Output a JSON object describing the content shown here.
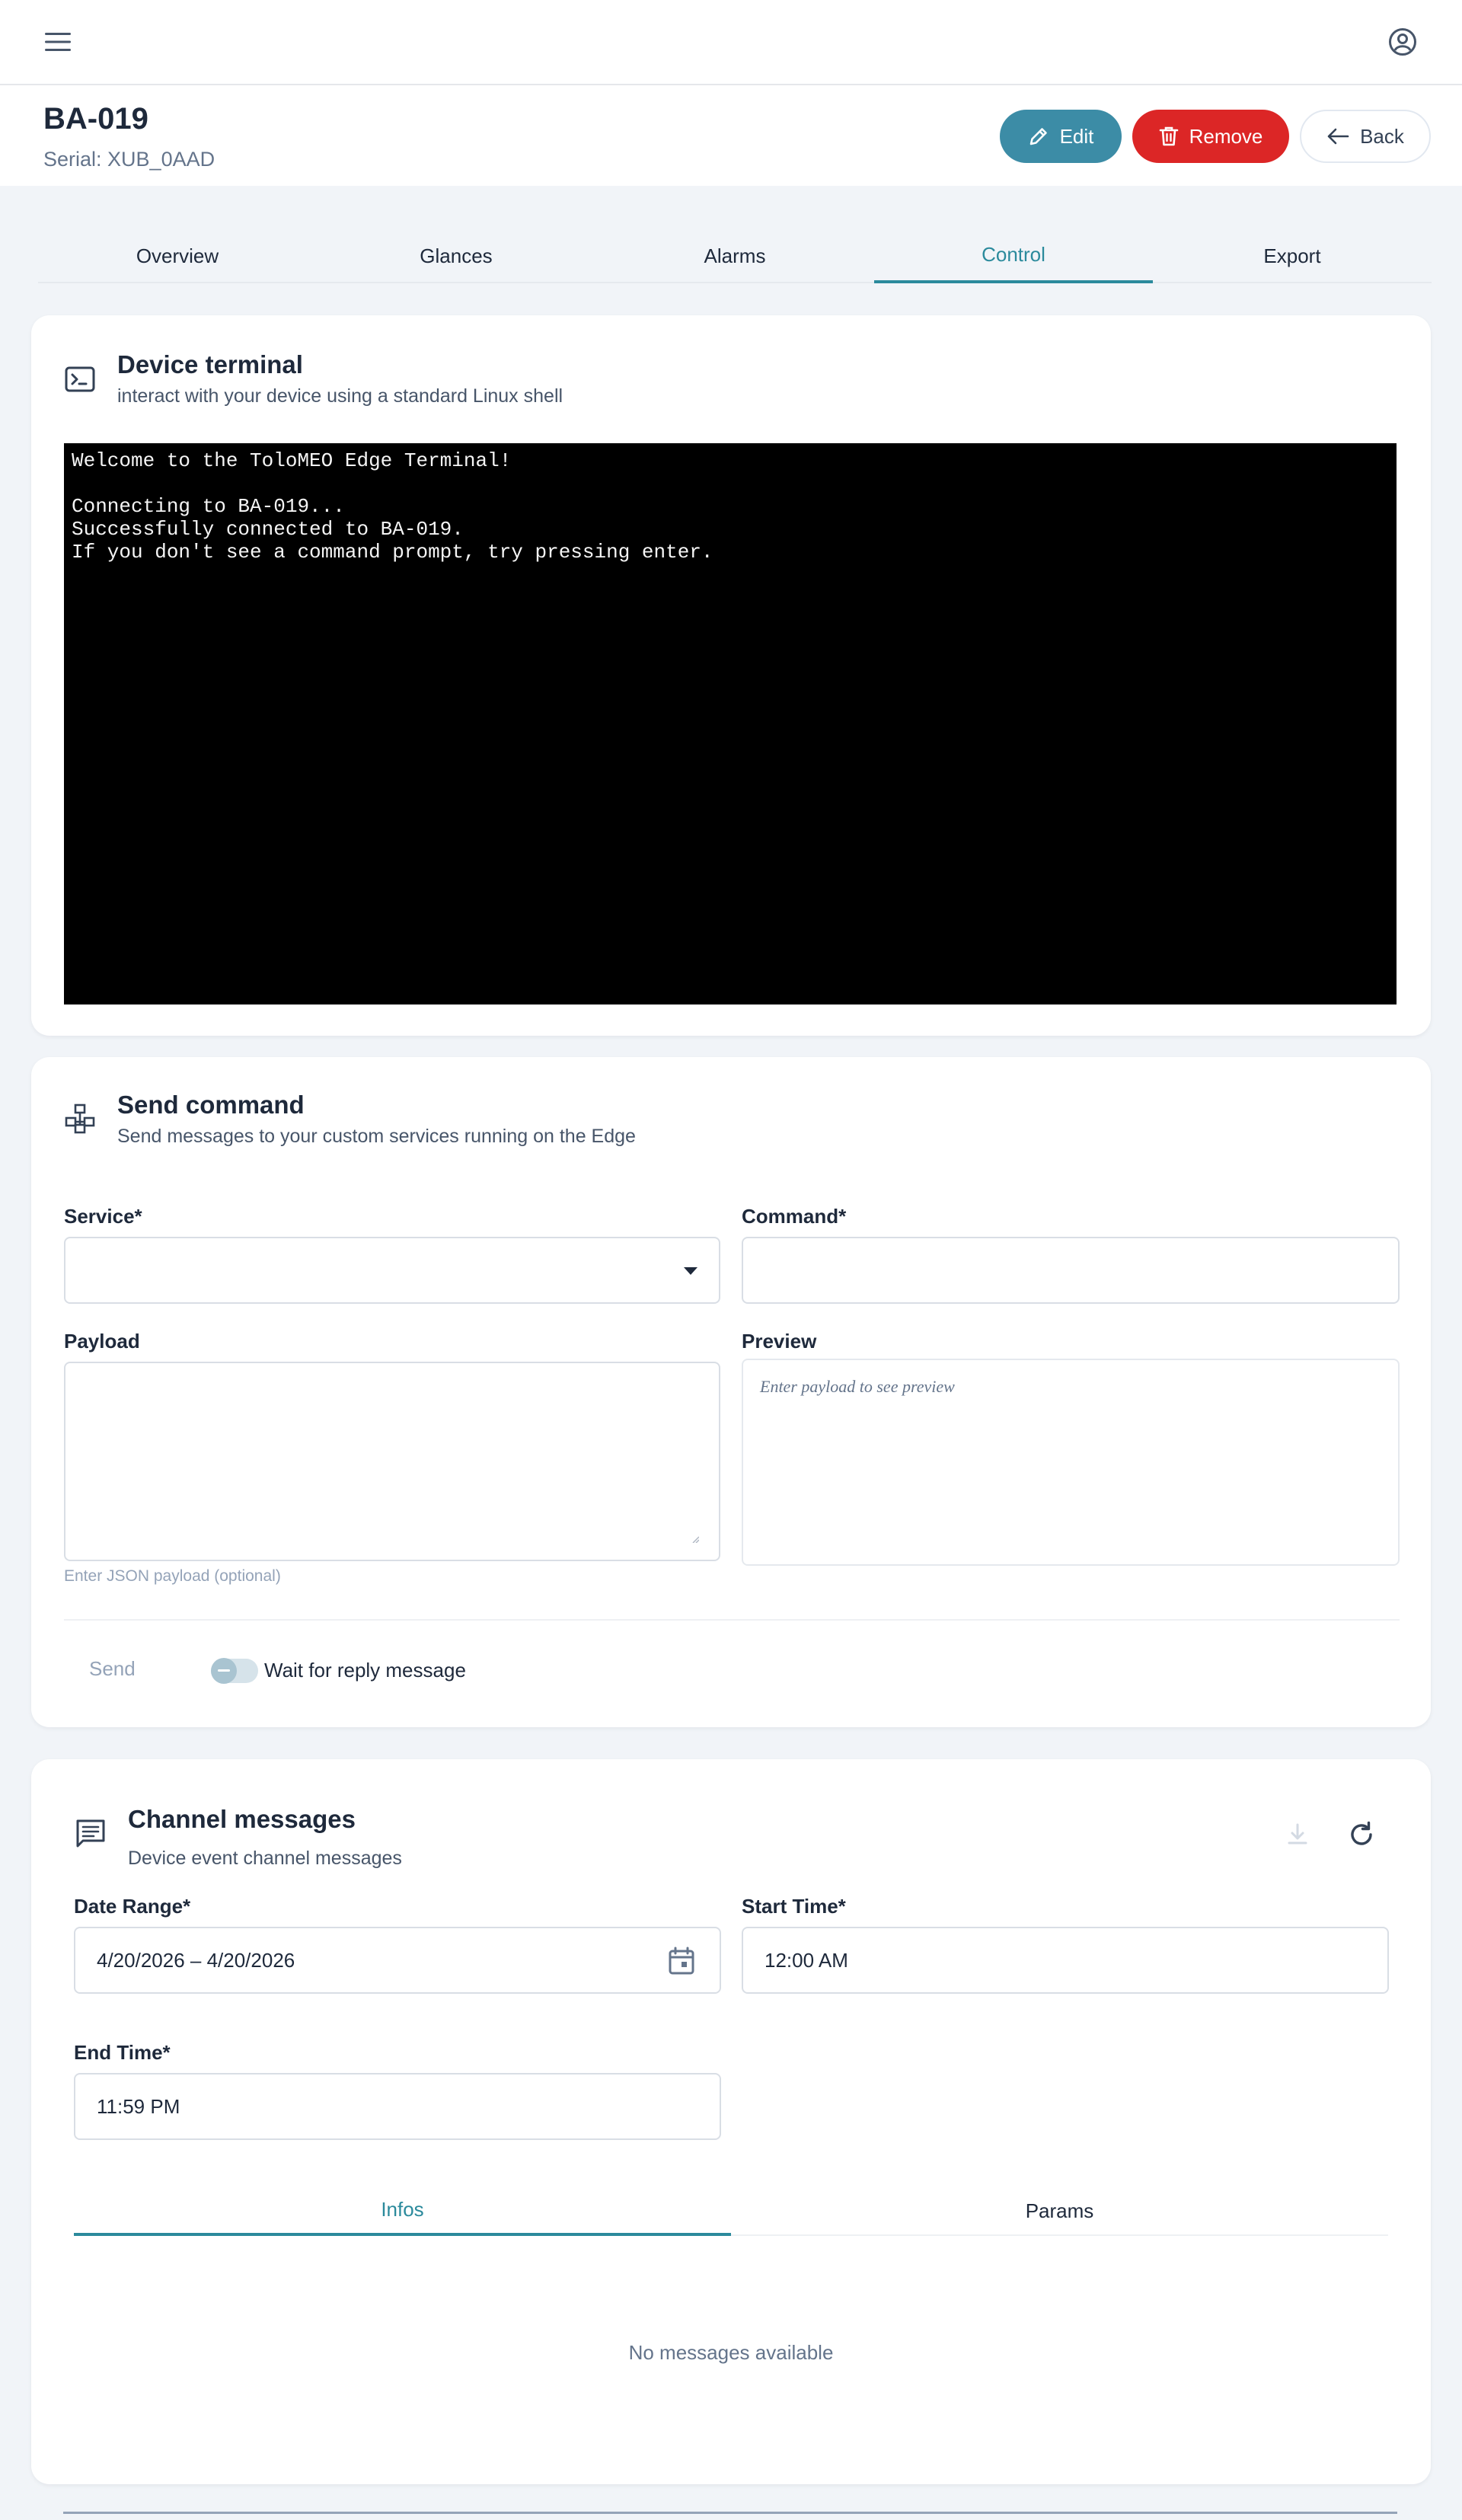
{
  "topbar": {
    "menu_icon": "menu-icon",
    "account_icon": "account-circle-icon"
  },
  "header": {
    "title": "BA-019",
    "serial": "Serial: XUB_0AAD",
    "edit_label": "Edit",
    "remove_label": "Remove",
    "back_label": "Back"
  },
  "tabs": [
    {
      "label": "Overview"
    },
    {
      "label": "Glances"
    },
    {
      "label": "Alarms"
    },
    {
      "label": "Control",
      "active": true
    },
    {
      "label": "Export"
    }
  ],
  "terminal_card": {
    "title": "Device terminal",
    "subtitle": "interact with your device using a standard Linux shell",
    "lines": [
      "Welcome to the ToloMEO Edge Terminal!",
      "",
      "Connecting to BA-019...",
      "Successfully connected to BA-019.",
      "If you don't see a command prompt, try pressing enter."
    ]
  },
  "command_card": {
    "title": "Send command",
    "subtitle": "Send messages to your custom services running on the Edge",
    "service_label": "Service*",
    "service_value": "",
    "command_label": "Command*",
    "command_value": "",
    "payload_label": "Payload",
    "payload_value": "",
    "payload_hint": "Enter JSON payload (optional)",
    "preview_label": "Preview",
    "preview_placeholder": "Enter payload to see preview",
    "send_label": "Send",
    "wait_label": "Wait for reply message",
    "wait_enabled": false
  },
  "channel_card": {
    "title": "Channel messages",
    "subtitle": "Device event channel messages",
    "date_range_label": "Date Range*",
    "date_range_value": "4/20/2026 – 4/20/2026",
    "start_time_label": "Start Time*",
    "start_time_value": "12:00 AM",
    "end_time_label": "End Time*",
    "end_time_value": "11:59 PM",
    "subtabs": [
      {
        "label": "Infos",
        "active": true
      },
      {
        "label": "Params"
      }
    ],
    "empty_message": "No messages available"
  },
  "colors": {
    "accent": "#2b8a9c",
    "edit": "#3c8ca6",
    "remove": "#dc2626",
    "background": "#f1f4f8"
  }
}
